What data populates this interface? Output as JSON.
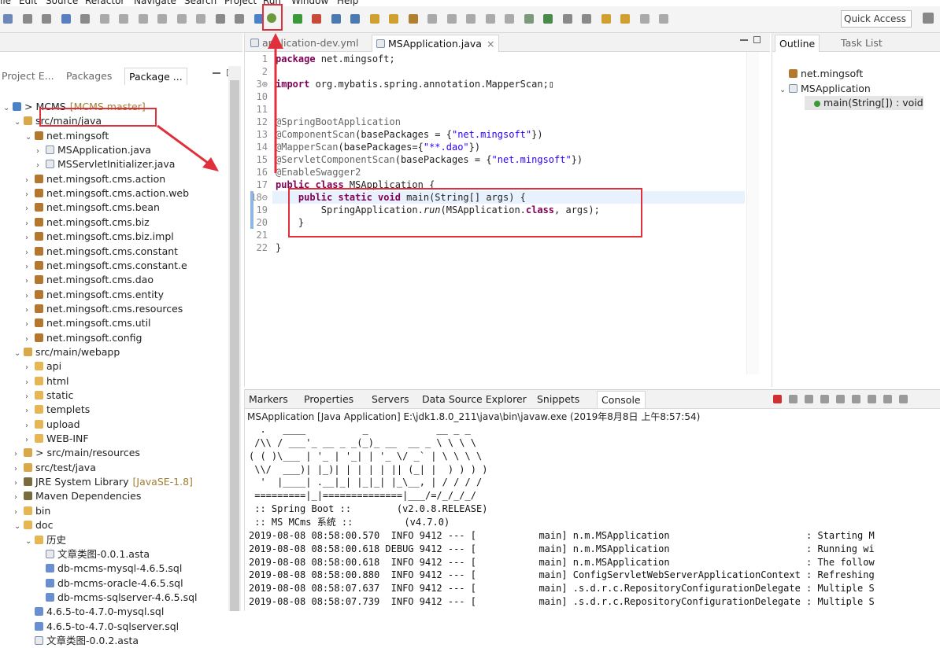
{
  "menu": [
    "ile",
    "Edit",
    "Source",
    "Refactor",
    "Navigate",
    "Search",
    "Project",
    "Run",
    "Window",
    "Help"
  ],
  "toolbar": {
    "quick_access": "Quick Access"
  },
  "left_panel": {
    "tabs": [
      "Project E...",
      "Packages",
      "Package ..."
    ],
    "tree": [
      {
        "arrow": "⌄",
        "icon": "proj",
        "label": "> MCMS",
        "suffix": "[MCMS master]",
        "indent": 0
      },
      {
        "arrow": "⌄",
        "icon": "src",
        "label": "src/main/java",
        "indent": 1
      },
      {
        "arrow": "⌄",
        "icon": "pkg",
        "label": "net.mingsoft",
        "indent": 2
      },
      {
        "arrow": "›",
        "icon": "java",
        "label": "MSApplication.java",
        "indent": 3
      },
      {
        "arrow": "›",
        "icon": "java",
        "label": "MSServletInitializer.java",
        "indent": 3
      },
      {
        "arrow": "›",
        "icon": "pkg",
        "label": "net.mingsoft.cms.action",
        "indent": 2
      },
      {
        "arrow": "›",
        "icon": "pkg",
        "label": "net.mingsoft.cms.action.web",
        "indent": 2
      },
      {
        "arrow": "›",
        "icon": "pkg",
        "label": "net.mingsoft.cms.bean",
        "indent": 2
      },
      {
        "arrow": "›",
        "icon": "pkg",
        "label": "net.mingsoft.cms.biz",
        "indent": 2
      },
      {
        "arrow": "›",
        "icon": "pkg",
        "label": "net.mingsoft.cms.biz.impl",
        "indent": 2
      },
      {
        "arrow": "›",
        "icon": "pkg",
        "label": "net.mingsoft.cms.constant",
        "indent": 2
      },
      {
        "arrow": "›",
        "icon": "pkg",
        "label": "net.mingsoft.cms.constant.e",
        "indent": 2
      },
      {
        "arrow": "›",
        "icon": "pkg",
        "label": "net.mingsoft.cms.dao",
        "indent": 2
      },
      {
        "arrow": "›",
        "icon": "pkg",
        "label": "net.mingsoft.cms.entity",
        "indent": 2
      },
      {
        "arrow": "›",
        "icon": "pkg",
        "label": "net.mingsoft.cms.resources",
        "indent": 2
      },
      {
        "arrow": "›",
        "icon": "pkg",
        "label": "net.mingsoft.cms.util",
        "indent": 2
      },
      {
        "arrow": "›",
        "icon": "pkg",
        "label": "net.mingsoft.config",
        "indent": 2
      },
      {
        "arrow": "⌄",
        "icon": "src",
        "label": "src/main/webapp",
        "indent": 1
      },
      {
        "arrow": "›",
        "icon": "fold",
        "label": "api",
        "indent": 2
      },
      {
        "arrow": "›",
        "icon": "fold",
        "label": "html",
        "indent": 2
      },
      {
        "arrow": "›",
        "icon": "fold",
        "label": "static",
        "indent": 2
      },
      {
        "arrow": "›",
        "icon": "fold",
        "label": "templets",
        "indent": 2
      },
      {
        "arrow": "›",
        "icon": "fold",
        "label": "upload",
        "indent": 2
      },
      {
        "arrow": "›",
        "icon": "fold",
        "label": "WEB-INF",
        "indent": 2
      },
      {
        "arrow": "›",
        "icon": "src",
        "label": "> src/main/resources",
        "indent": 1
      },
      {
        "arrow": "›",
        "icon": "src",
        "label": "src/test/java",
        "indent": 1
      },
      {
        "arrow": "›",
        "icon": "jar",
        "label": "JRE System Library",
        "suffix": "[JavaSE-1.8]",
        "indent": 1
      },
      {
        "arrow": "›",
        "icon": "jar",
        "label": "Maven Dependencies",
        "indent": 1
      },
      {
        "arrow": "›",
        "icon": "fold",
        "label": "bin",
        "indent": 1
      },
      {
        "arrow": "⌄",
        "icon": "fold",
        "label": "doc",
        "indent": 1
      },
      {
        "arrow": "⌄",
        "icon": "fold",
        "label": "历史",
        "indent": 2
      },
      {
        "arrow": "",
        "icon": "java",
        "label": "文章类图-0.0.1.asta",
        "indent": 3
      },
      {
        "arrow": "",
        "icon": "sql",
        "label": "db-mcms-mysql-4.6.5.sql",
        "indent": 3
      },
      {
        "arrow": "",
        "icon": "sql",
        "label": "db-mcms-oracle-4.6.5.sql",
        "indent": 3
      },
      {
        "arrow": "",
        "icon": "sql",
        "label": "db-mcms-sqlserver-4.6.5.sql",
        "indent": 3
      },
      {
        "arrow": "",
        "icon": "sql",
        "label": "4.6.5-to-4.7.0-mysql.sql",
        "indent": 2
      },
      {
        "arrow": "",
        "icon": "sql",
        "label": "4.6.5-to-4.7.0-sqlserver.sql",
        "indent": 2
      },
      {
        "arrow": "",
        "icon": "java",
        "label": "文章类图-0.0.2.asta",
        "indent": 2
      }
    ]
  },
  "editor": {
    "tabs": [
      "application-dev.yml",
      "MSApplication.java"
    ],
    "lines": [
      {
        "n": "1",
        "html": "<span class='kw'>package</span> net.mingsoft;"
      },
      {
        "n": "2",
        "html": ""
      },
      {
        "n": "3⊕",
        "html": "<span class='kw'>import</span> org.mybatis.spring.annotation.MapperScan;▯"
      },
      {
        "n": "10",
        "html": ""
      },
      {
        "n": "11",
        "html": ""
      },
      {
        "n": "12",
        "html": "<span class='ann'>@SpringBootApplication</span>"
      },
      {
        "n": "13",
        "html": "<span class='ann'>@ComponentScan</span>(basePackages = {<span class='str'>\"net.mingsoft\"</span>})"
      },
      {
        "n": "14",
        "html": "<span class='ann'>@MapperScan</span>(basePackages={<span class='str'>\"**.dao\"</span>})"
      },
      {
        "n": "15",
        "html": "<span class='ann'>@ServletComponentScan</span>(basePackages = {<span class='str'>\"net.mingsoft\"</span>})"
      },
      {
        "n": "16",
        "html": "<span class='ann'>@EnableSwagger2</span>"
      },
      {
        "n": "17",
        "html": "<span class='kw'>public class</span> MSApplication {"
      },
      {
        "n": "18⊖",
        "html": "    <span class='kw'>public static void</span> main(String[] args) {"
      },
      {
        "n": "19",
        "html": "        SpringApplication.<span class='it'>run</span>(MSApplication.<span class='kw'>class</span>, args);"
      },
      {
        "n": "20",
        "html": "    }"
      },
      {
        "n": "21",
        "html": ""
      },
      {
        "n": "22",
        "html": "}"
      }
    ]
  },
  "outline": {
    "tabs": [
      "Outline",
      "Task List"
    ],
    "items": [
      {
        "label": "net.mingsoft",
        "indent": 0
      },
      {
        "label": "MSApplication",
        "indent": 0,
        "arrow": "⌄"
      },
      {
        "label": "main(String[]) : void",
        "indent": 1
      }
    ]
  },
  "console": {
    "tabs": [
      "Markers",
      "Properties",
      "Servers",
      "Data Source Explorer",
      "Snippets",
      "Console"
    ],
    "header": "MSApplication [Java Application] E:\\jdk1.8.0_211\\java\\bin\\javaw.exe (2019年8月8日 上午8:57:54)",
    "banner": [
      "  .   ____          _            __ _ _",
      " /\\\\ / ___'_ __ _ _(_)_ __  __ _ \\ \\ \\ \\",
      "( ( )\\___ | '_ | '_| | '_ \\/ _` | \\ \\ \\ \\",
      " \\\\/  ___)| |_)| | | | | || (_| |  ) ) ) )",
      "  '  |____| .__|_| |_|_| |_\\__, | / / / /",
      " =========|_|==============|___/=/_/_/_/",
      " :: Spring Boot ::        (v2.0.8.RELEASE)",
      " :: MS MCms 系统 ::         (v4.7.0)"
    ],
    "logs": [
      "2019-08-08 08:58:00.570  INFO 9412 --- [           main] n.m.MSApplication                        : Starting M",
      "2019-08-08 08:58:00.618 DEBUG 9412 --- [           main] n.m.MSApplication                        : Running wi",
      "2019-08-08 08:58:00.618  INFO 9412 --- [           main] n.m.MSApplication                        : The follow",
      "2019-08-08 08:58:00.880  INFO 9412 --- [           main] ConfigServletWebServerApplicationContext : Refreshing",
      "2019-08-08 08:58:07.637  INFO 9412 --- [           main] .s.d.r.c.RepositoryConfigurationDelegate : Multiple S",
      "2019-08-08 08:58:07.739  INFO 9412 --- [           main] .s.d.r.c.RepositoryConfigurationDelegate : Multiple S"
    ]
  },
  "colors": {
    "highlight": "#e0303c",
    "keyword": "#7f0055",
    "string": "#2a00ff"
  }
}
